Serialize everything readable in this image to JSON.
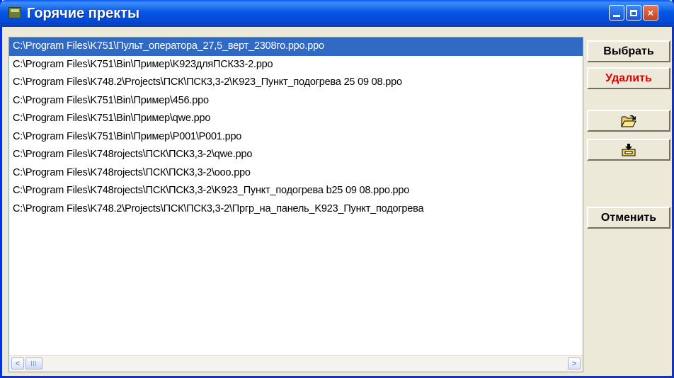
{
  "window": {
    "title": "Горячие пректы"
  },
  "titlebar_buttons": {
    "minimize": "minimize-icon",
    "maximize": "maximize-icon",
    "close": "×"
  },
  "files": [
    "C:\\Program Files\\K751\\Пульт_оператора_27,5_верт_2308го.ppo.ppo",
    "C:\\Program Files\\K751\\Bin\\Пример\\K923дляПСК33-2.ppo",
    "C:\\Program Files\\K748.2\\Projects\\ПСК\\ПСК3,3-2\\K923_Пункт_подогрева 25 09 08.ppo",
    "C:\\Program Files\\K751\\Bin\\Пример\\456.ppo",
    "C:\\Program Files\\K751\\Bin\\Пример\\qwe.ppo",
    "C:\\Program Files\\K751\\Bin\\Пример\\P001\\P001.ppo",
    "C:\\Program Files\\K748rojects\\ПСК\\ПСК3,3-2\\qwe.ppo",
    "C:\\Program Files\\K748rojects\\ПСК\\ПСК3,3-2\\ooo.ppo",
    "C:\\Program Files\\K748rojects\\ПСК\\ПСК3,3-2\\K923_Пункт_подогрева b25 09 08.ppo.ppo",
    "C:\\Program Files\\K748.2\\Projects\\ПСК\\ПСК3,3-2\\Пргр_на_панель_K923_Пункт_подогрева"
  ],
  "selected_index": 0,
  "buttons": {
    "select": "Выбрать",
    "delete": "Удалить",
    "open_icon": "open-folder-icon",
    "import_icon": "import-tray-icon",
    "cancel": "Отменить"
  },
  "scrollbar": {
    "left_arrow": "<",
    "right_arrow": ">"
  },
  "colors": {
    "selection": "#316ac5",
    "delete_text": "#e00000",
    "titlebar": "#0556e5"
  }
}
